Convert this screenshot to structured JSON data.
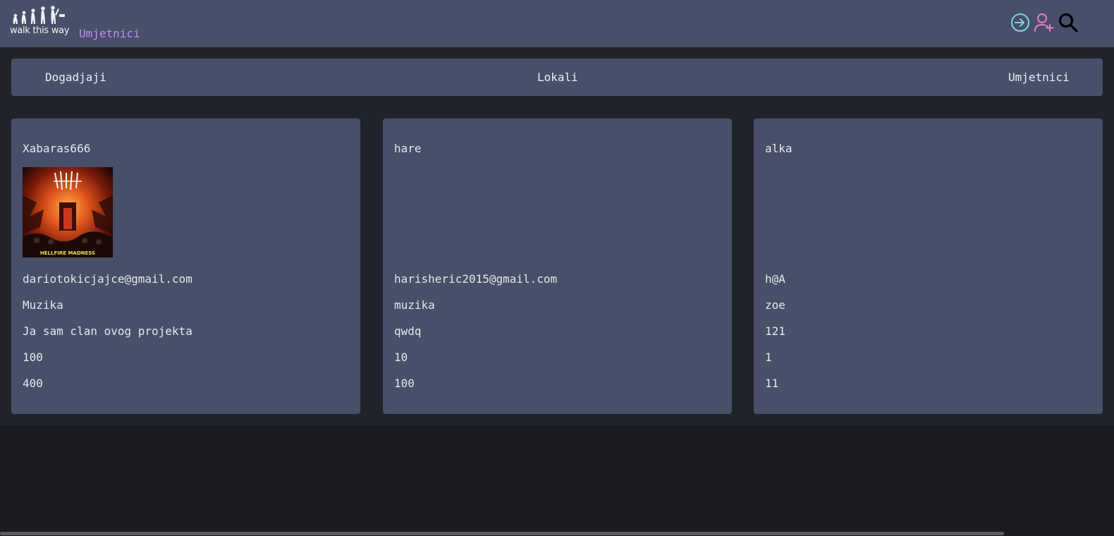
{
  "header": {
    "logo_text": "walk this way",
    "current_page": "Umjetnici",
    "icons": [
      "login-icon",
      "add-user-icon",
      "search-icon"
    ],
    "accent_color": "#c58af9"
  },
  "nav": {
    "events": "Dogadjaji",
    "venues": "Lokali",
    "artists": "Umjetnici"
  },
  "artists": [
    {
      "name": "Xabaras666",
      "album_art_caption": "HELLFIRE MADNESS",
      "email": "dariotokicjajce@gmail.com",
      "category": "Muzika",
      "description": "Ja sam clan ovog projekta",
      "value1": "100",
      "value2": "400"
    },
    {
      "name": "hare",
      "email": "harisheric2015@gmail.com",
      "category": "muzika",
      "description": "qwdq",
      "value1": "10",
      "value2": "100"
    },
    {
      "name": "alka",
      "email": "h@A",
      "category": "zoe",
      "description": "121",
      "value1": "1",
      "value2": "11"
    }
  ]
}
